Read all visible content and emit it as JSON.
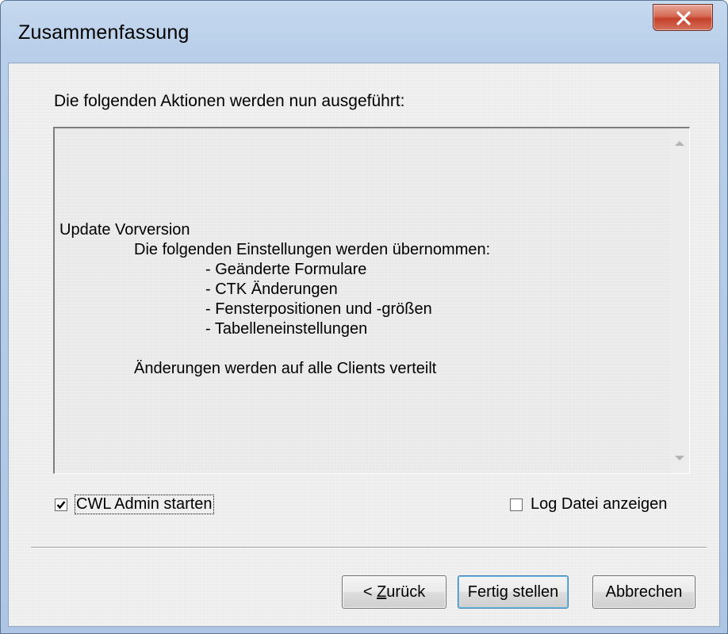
{
  "window": {
    "title": "Zusammenfassung",
    "close_glyph": "✕"
  },
  "intro_text": "Die folgenden Aktionen werden nun ausgeführt:",
  "summary": {
    "heading": "Update Vorversion",
    "subheading": "Die folgenden Einstellungen werden übernommen:",
    "items": [
      "- Geänderte Formulare",
      "- CTK Änderungen",
      "- Fensterpositionen und -größen",
      "- Tabelleneinstellungen"
    ],
    "footer": "Änderungen werden auf alle Clients verteilt"
  },
  "options": {
    "start_admin": {
      "label": "CWL Admin starten",
      "checked": true
    },
    "show_log": {
      "label": "Log Datei anzeigen",
      "checked": false
    }
  },
  "buttons": {
    "back_prefix": "< ",
    "back_mnemonic": "Z",
    "back_rest": "urück",
    "finish": "Fertig stellen",
    "cancel": "Abbrechen"
  },
  "colors": {
    "window_frame": "#aec6e4",
    "dialog_bg": "#f0f0f0",
    "close_button": "#c4412a",
    "default_button_border": "#3c7fb1"
  },
  "icons": {
    "close": "close-icon",
    "scroll_up": "scroll-up-arrow-icon",
    "scroll_down": "scroll-down-arrow-icon",
    "checkmark": "checkmark-icon"
  }
}
